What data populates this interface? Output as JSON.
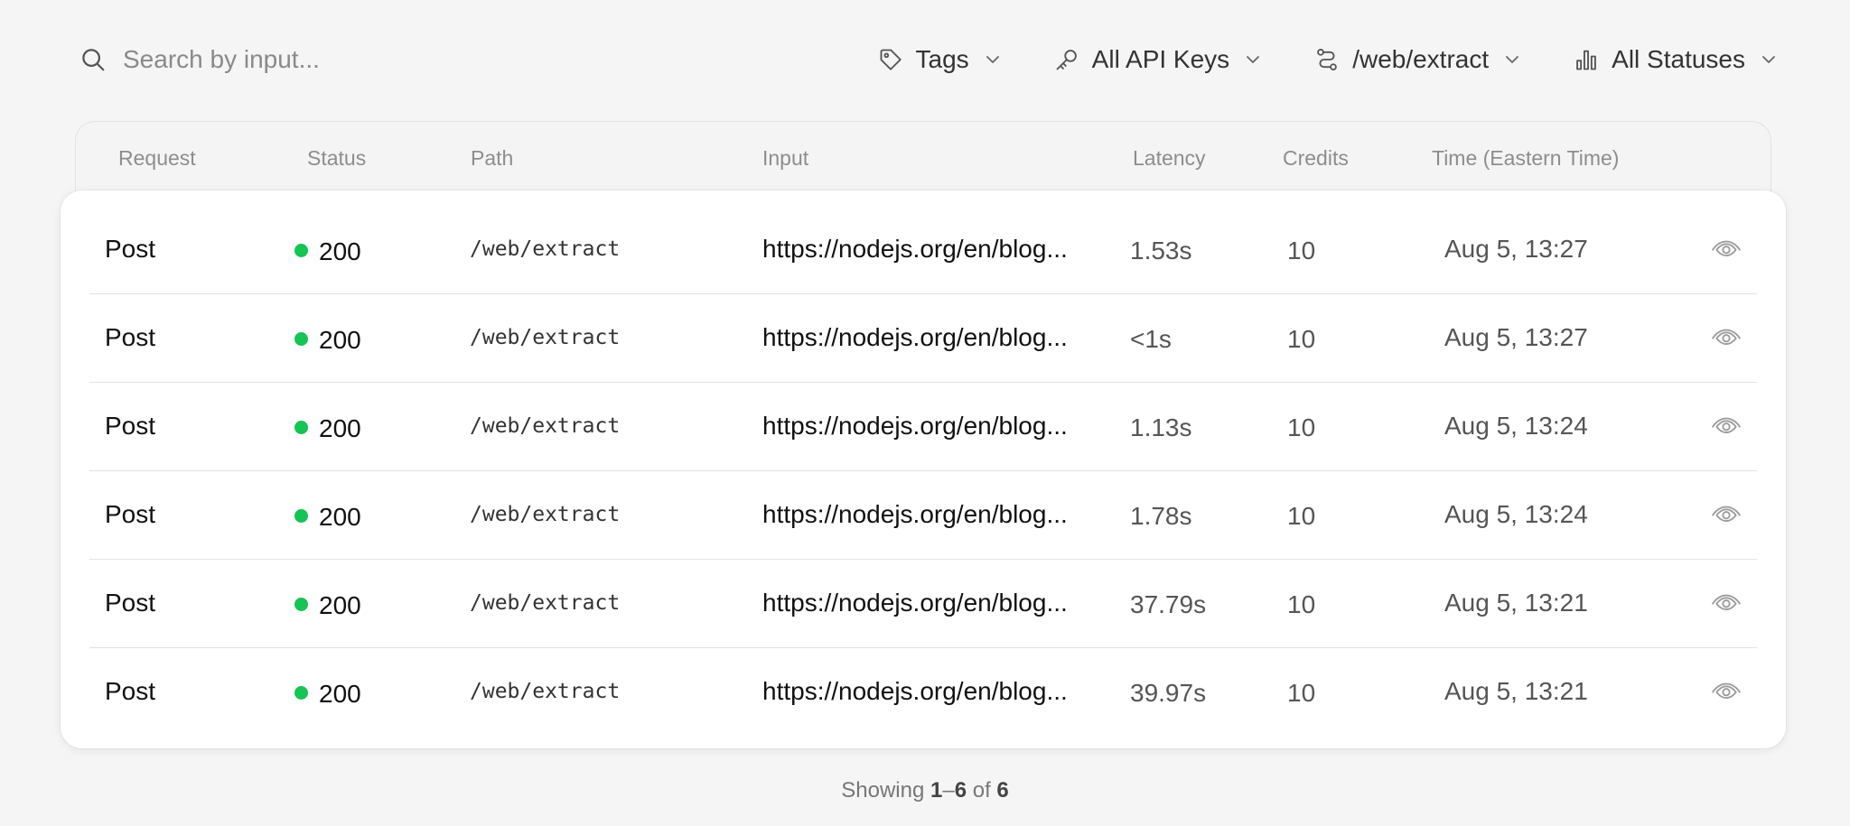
{
  "search": {
    "placeholder": "Search by input...",
    "value": ""
  },
  "filters": [
    {
      "label": "Tags",
      "icon": "tag-icon"
    },
    {
      "label": "All API Keys",
      "icon": "key-icon"
    },
    {
      "label": "/web/extract",
      "icon": "route-icon"
    },
    {
      "label": "All Statuses",
      "icon": "bar-chart-icon"
    }
  ],
  "table": {
    "columns": [
      "Request",
      "Status",
      "Path",
      "Input",
      "Latency",
      "Credits",
      "Time (Eastern Time)"
    ],
    "rows": [
      {
        "request": "Post",
        "status": "200",
        "path": "/web/extract",
        "input": "https://nodejs.org/en/blog...",
        "latency": "1.53s",
        "credits": "10",
        "time": "Aug 5, 13:27"
      },
      {
        "request": "Post",
        "status": "200",
        "path": "/web/extract",
        "input": "https://nodejs.org/en/blog...",
        "latency": "<1s",
        "credits": "10",
        "time": "Aug 5, 13:27"
      },
      {
        "request": "Post",
        "status": "200",
        "path": "/web/extract",
        "input": "https://nodejs.org/en/blog...",
        "latency": "1.13s",
        "credits": "10",
        "time": "Aug 5, 13:24"
      },
      {
        "request": "Post",
        "status": "200",
        "path": "/web/extract",
        "input": "https://nodejs.org/en/blog...",
        "latency": "1.78s",
        "credits": "10",
        "time": "Aug 5, 13:24"
      },
      {
        "request": "Post",
        "status": "200",
        "path": "/web/extract",
        "input": "https://nodejs.org/en/blog...",
        "latency": "37.79s",
        "credits": "10",
        "time": "Aug 5, 13:21"
      },
      {
        "request": "Post",
        "status": "200",
        "path": "/web/extract",
        "input": "https://nodejs.org/en/blog...",
        "latency": "39.97s",
        "credits": "10",
        "time": "Aug 5, 13:21"
      }
    ],
    "status_color": "#14c454",
    "view_icon": "eye-icon"
  },
  "pagination": {
    "prefix": "Showing",
    "start": "1",
    "dash": "–",
    "end": "6",
    "of": "of",
    "total": "6"
  }
}
